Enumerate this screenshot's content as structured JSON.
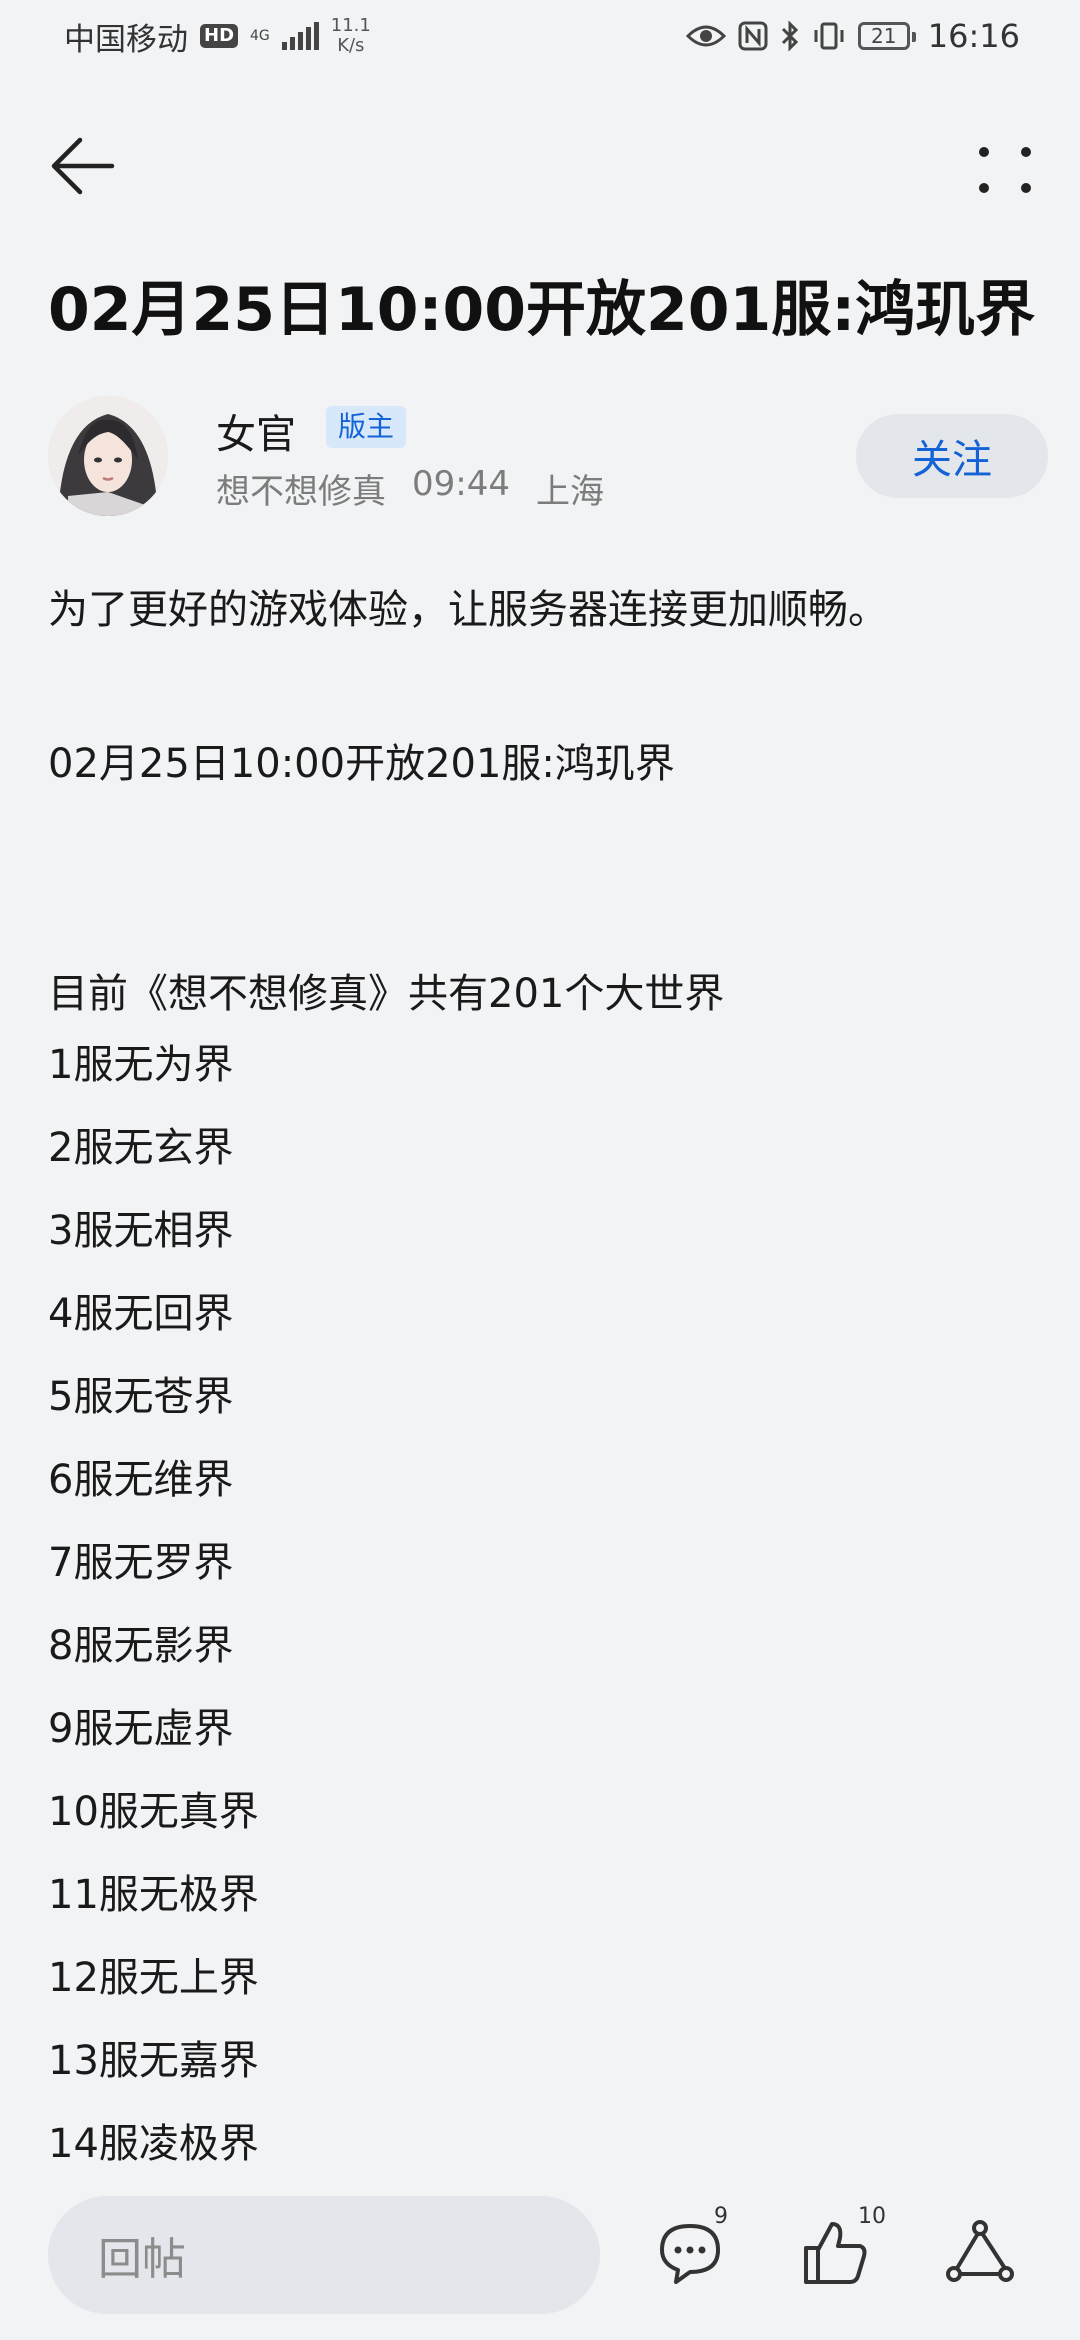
{
  "status_bar": {
    "carrier": "中国移动",
    "hd": "HD",
    "net_top": "4G",
    "speed_value": "11.1",
    "speed_unit": "K/s",
    "battery": "21",
    "time": "16:16"
  },
  "post": {
    "title": "02月25日10:00开放201服:鸿玑界",
    "author": {
      "name": "女官",
      "badge": "版主",
      "forum": "想不想修真",
      "time": "09:44",
      "location": "上海",
      "follow_label": "关注"
    },
    "intro": "为了更好的游戏体验，让服务器连接更加顺畅。",
    "open_line": "02月25日10:00开放201服:鸿玑界",
    "summary": "目前《想不想修真》共有201个大世界",
    "servers": [
      "1服无为界",
      "2服无玄界",
      "3服无相界",
      "4服无回界",
      "5服无苍界",
      "6服无维界",
      "7服无罗界",
      "8服无影界",
      "9服无虚界",
      "10服无真界",
      "11服无极界",
      "12服无上界",
      "13服无嘉界",
      "14服凌极界"
    ]
  },
  "bottom_bar": {
    "reply_placeholder": "回帖",
    "comment_count": "9",
    "like_count": "10"
  },
  "colors": {
    "accent": "#1463d6",
    "background": "#f1f3f5",
    "pill": "#e3e6ea"
  }
}
